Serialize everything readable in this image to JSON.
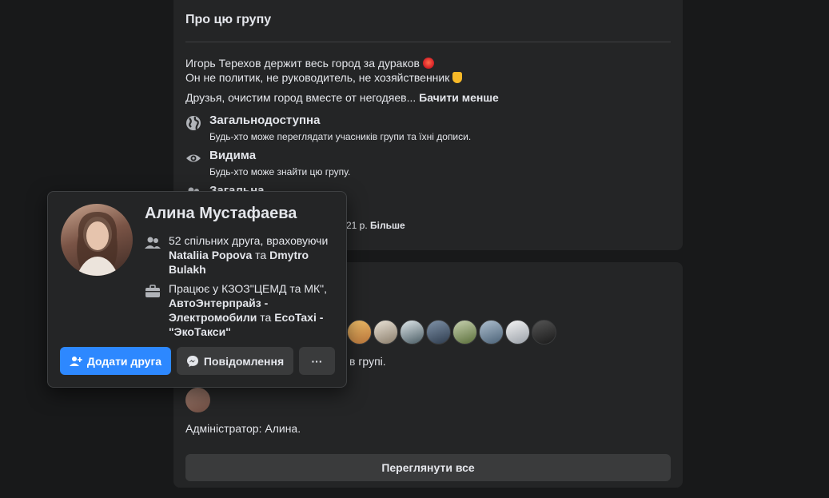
{
  "about": {
    "title": "Про цю групу",
    "desc_line1": "Игорь Терехов держит весь город за дураков",
    "desc_line2": "Он не политик, не руководитель, не хозяйственник",
    "desc_line3": "Друзья, очистим город вместе от негодяев...",
    "see_less": "Бачити менше",
    "privacy_title": "Загальнодоступна",
    "privacy_sub": "Будь-хто може переглядати учасників групи та їхні дописи.",
    "visible_title": "Видима",
    "visible_sub": "Будь-хто може знайти цю групу.",
    "general_title": "Загальна",
    "history_text": "21 р.",
    "more_label": "Більше"
  },
  "members": {
    "member_text": "в групі.",
    "admin_text": "Адміністратор: Алина.",
    "see_all": "Переглянути все"
  },
  "hovercard": {
    "name": "Алина Мустафаева",
    "mutual_prefix": "52 спільних друга, враховуючи",
    "mutual_name1": "Nataliia Popova",
    "mutual_and": "та",
    "mutual_name2": "Dmytro Bulakh",
    "work_prefix": "Працює у КЗОЗ\"ЦЕМД та МК\",",
    "work_org1": "АвтоЭнтерпрайз - Электромобили",
    "work_and": "та",
    "work_org2": "EcoTaxi - \"ЭкоТакси\"",
    "add_friend": "Додати друга",
    "message": "Повідомлення",
    "more": "···"
  },
  "colors": {
    "background": "#18191a",
    "card": "#242526",
    "primary": "#2d88ff",
    "secondary_button": "#3a3b3c"
  }
}
